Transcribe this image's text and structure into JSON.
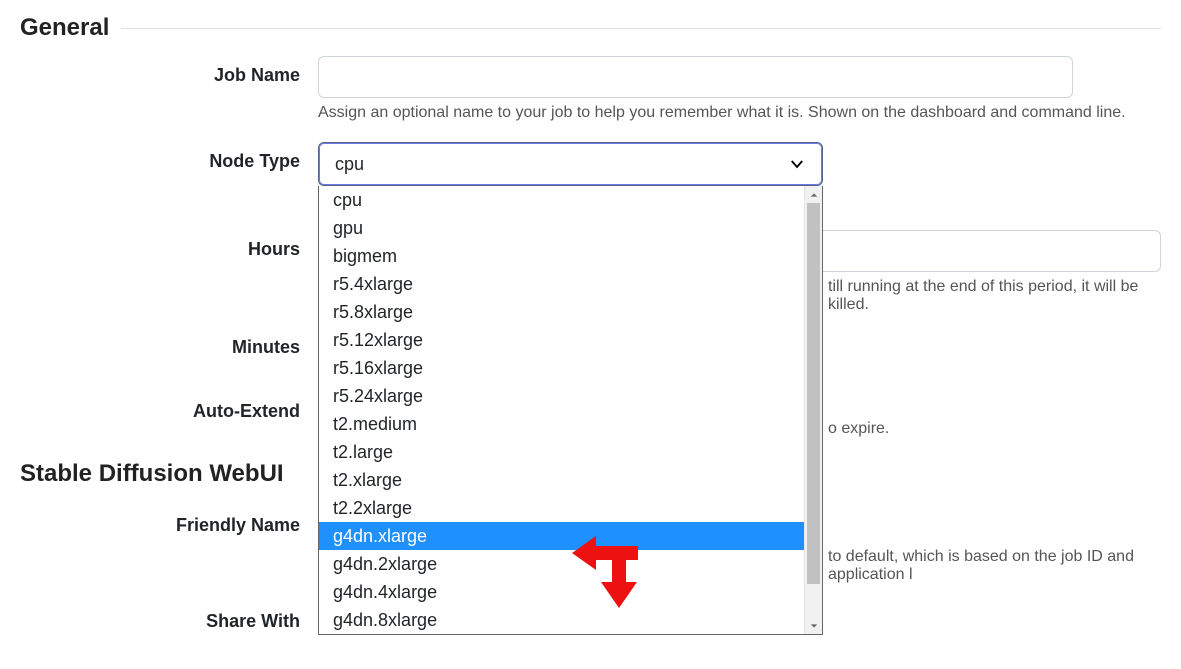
{
  "sections": {
    "general_title": "General",
    "sd_title": "Stable Diffusion WebUI"
  },
  "general": {
    "job_name_label": "Job Name",
    "job_name_value": "",
    "job_name_help": "Assign an optional name to your job to help you remember what it is. Shown on the dashboard and command line.",
    "node_type_label": "Node Type",
    "node_type_selected": "cpu",
    "node_type_options": [
      "cpu",
      "gpu",
      "bigmem",
      "r5.4xlarge",
      "r5.8xlarge",
      "r5.12xlarge",
      "r5.16xlarge",
      "r5.24xlarge",
      "t2.medium",
      "t2.large",
      "t2.xlarge",
      "t2.2xlarge",
      "g4dn.xlarge",
      "g4dn.2xlarge",
      "g4dn.4xlarge",
      "g4dn.8xlarge"
    ],
    "node_type_highlight": "g4dn.xlarge",
    "hours_label": "Hours",
    "hours_help_fragment": "till running at the end of this period, it will be killed.",
    "minutes_label": "Minutes",
    "auto_extend_label": "Auto-Extend",
    "auto_extend_help_fragment": "o expire."
  },
  "sd": {
    "friendly_name_label": "Friendly Name",
    "friendly_name_help_fragment": "to default, which is based on the job ID and application l",
    "share_with_label": "Share With"
  },
  "colors": {
    "highlight": "#1e90ff",
    "annotation": "#e11"
  }
}
